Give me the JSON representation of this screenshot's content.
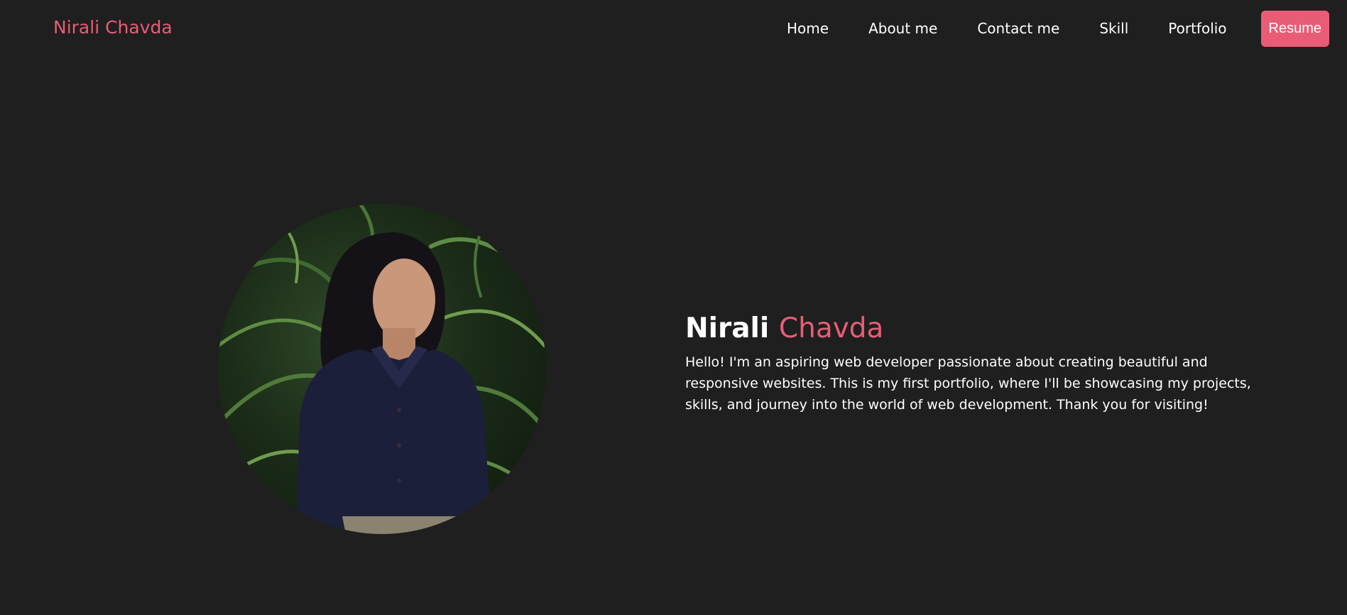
{
  "brand": {
    "name": "Nirali Chavda"
  },
  "nav": {
    "items": [
      "Home",
      "About me",
      "Contact me",
      "Skill",
      "Portfolio"
    ],
    "resume_label": "Resume"
  },
  "hero": {
    "first_name": "Nirali",
    "last_name": "Chavda",
    "description": "Hello! I'm an aspiring web developer passionate about creating beautiful and responsive websites. This is my first portfolio, where I'll be showcasing my projects, skills, and journey into the world of web development. Thank you for visiting!"
  },
  "colors": {
    "background": "#1f1f1f",
    "accent": "#e85d75",
    "text": "#ffffff"
  }
}
